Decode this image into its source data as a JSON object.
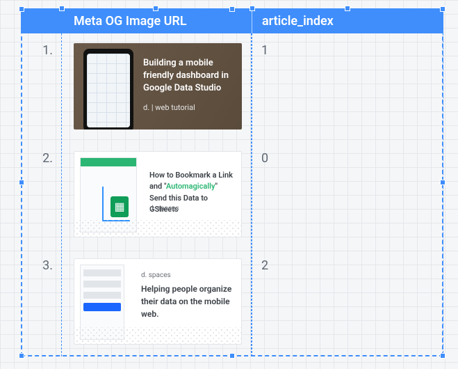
{
  "columns": {
    "image_header": "Meta OG Image URL",
    "index_header": "article_index"
  },
  "rows": [
    {
      "num": "1.",
      "index": "1",
      "thumb": {
        "title": "Building a mobile friendly dashboard in Google Data Studio",
        "sub": "d. | web tutorial"
      }
    },
    {
      "num": "2.",
      "index": "0",
      "thumb": {
        "title_pre": "How to Bookmark a Link and \"",
        "title_accent": "Automagically",
        "title_post": "\" Send this Data to GSheets",
        "sub": "d. spaces"
      }
    },
    {
      "num": "3.",
      "index": "2",
      "thumb": {
        "title": "Helping people organize their data on the mobile web.",
        "sub": "d. spaces"
      }
    }
  ],
  "colors": {
    "accent": "#3f8efc"
  }
}
